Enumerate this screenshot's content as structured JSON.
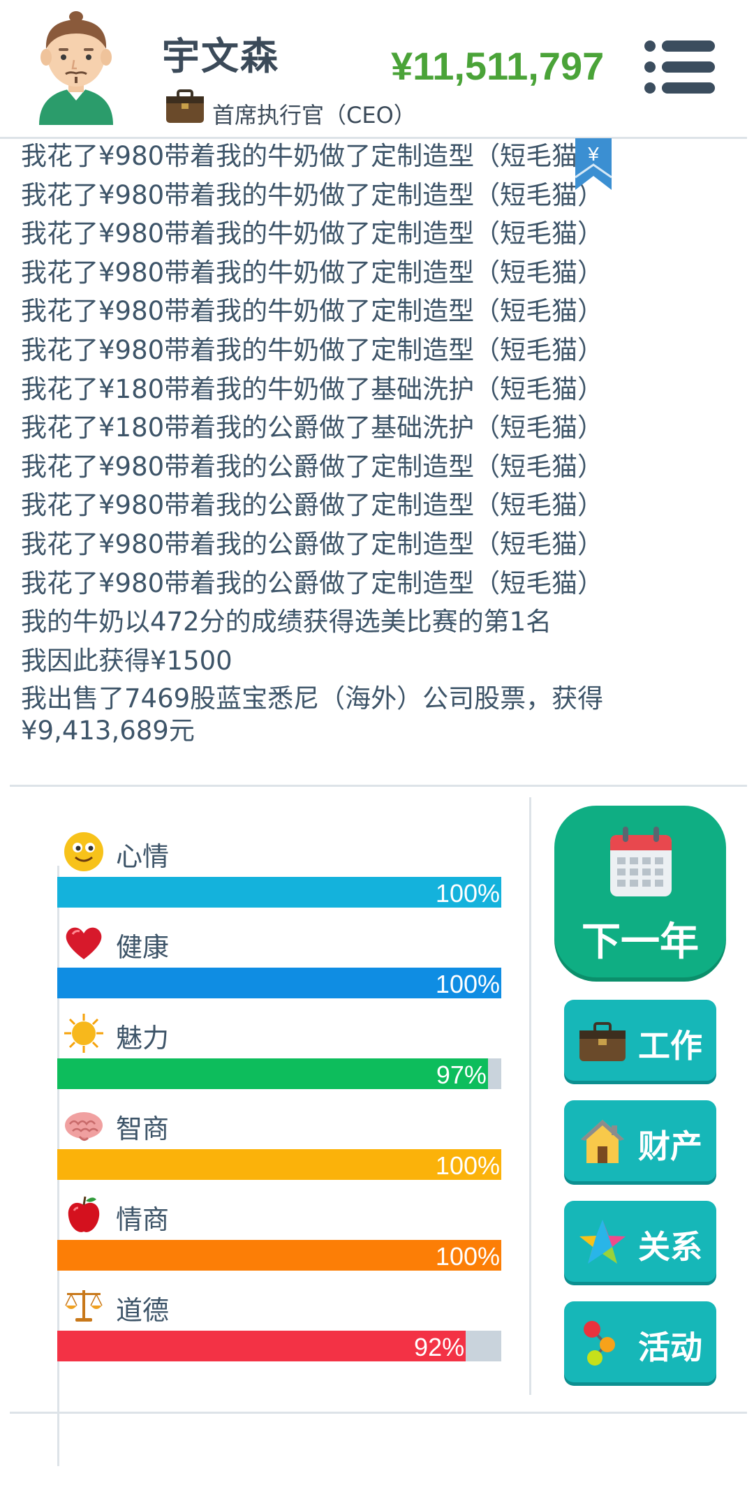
{
  "header": {
    "name": "宇文森",
    "job_title": "首席执行官（CEO）",
    "money": "¥11,511,797"
  },
  "log": {
    "lines": [
      "我花了¥980带着我的牛奶做了定制造型（短毛猫）",
      "我花了¥980带着我的牛奶做了定制造型（短毛猫）",
      "我花了¥980带着我的牛奶做了定制造型（短毛猫）",
      "我花了¥980带着我的牛奶做了定制造型（短毛猫）",
      "我花了¥980带着我的牛奶做了定制造型（短毛猫）",
      "我花了¥980带着我的牛奶做了定制造型（短毛猫）",
      "我花了¥180带着我的牛奶做了基础洗护（短毛猫）",
      "我花了¥180带着我的公爵做了基础洗护（短毛猫）",
      "我花了¥980带着我的公爵做了定制造型（短毛猫）",
      "我花了¥980带着我的公爵做了定制造型（短毛猫）",
      "我花了¥980带着我的公爵做了定制造型（短毛猫）",
      "我花了¥980带着我的公爵做了定制造型（短毛猫）",
      "我的牛奶以472分的成绩获得选美比赛的第1名",
      "我因此获得¥1500",
      "我出售了7469股蓝宝悉尼（海外）公司股票，获得¥9,413,689元"
    ],
    "bookmark_symbol": "¥"
  },
  "stats": [
    {
      "label": "心情",
      "value": 100,
      "pct": "100%",
      "color": "#14b2dc",
      "icon": "smiley-icon"
    },
    {
      "label": "健康",
      "value": 100,
      "pct": "100%",
      "color": "#0f8de3",
      "icon": "heart-icon"
    },
    {
      "label": "魅力",
      "value": 97,
      "pct": "97%",
      "color": "#0dbd5c",
      "icon": "sun-icon"
    },
    {
      "label": "智商",
      "value": 100,
      "pct": "100%",
      "color": "#fbb20a",
      "icon": "brain-icon"
    },
    {
      "label": "情商",
      "value": 100,
      "pct": "100%",
      "color": "#fc7e06",
      "icon": "apple-icon"
    },
    {
      "label": "道德",
      "value": 92,
      "pct": "92%",
      "color": "#f33245",
      "icon": "scales-icon"
    }
  ],
  "buttons": {
    "next_year": "下一年",
    "work": "工作",
    "property": "财产",
    "relations": "关系",
    "activities": "活动"
  }
}
